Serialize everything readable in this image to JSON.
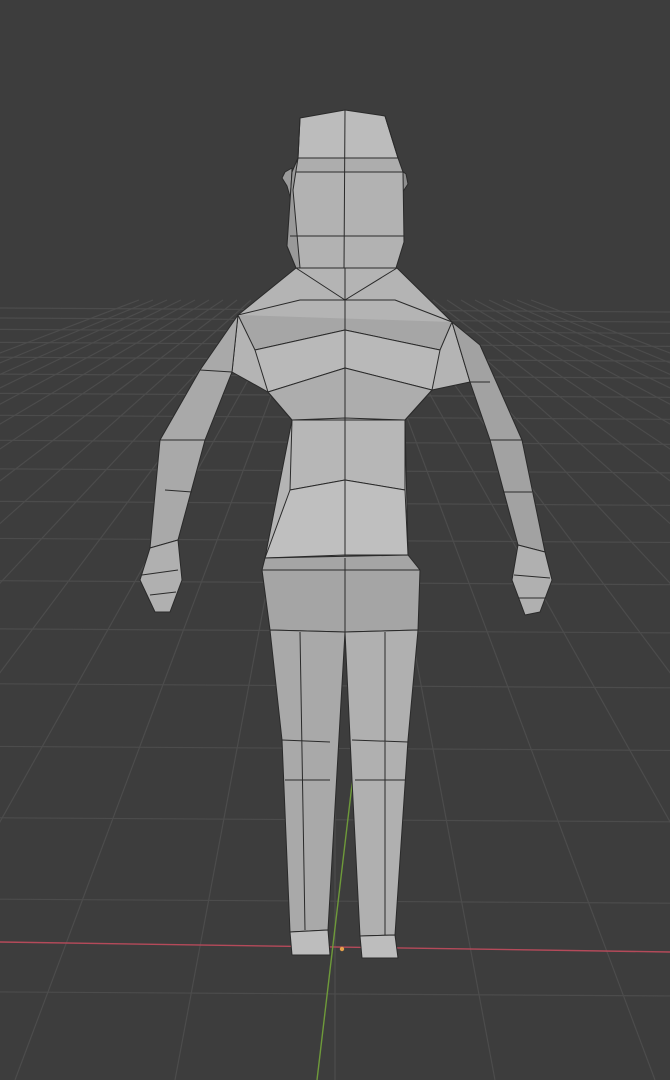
{
  "viewport": {
    "background_color": "#3d3d3d",
    "grid_color": "#4c4c4c",
    "x_axis_color": "#b54a5a",
    "y_axis_color": "#6e9a3a",
    "origin_color": "#e6a14a"
  },
  "model": {
    "face_color": "#adadad",
    "face_light": "#bcbcbc",
    "face_dark": "#8f8f8f",
    "edge_color": "#2a2a2a",
    "view": "back"
  }
}
